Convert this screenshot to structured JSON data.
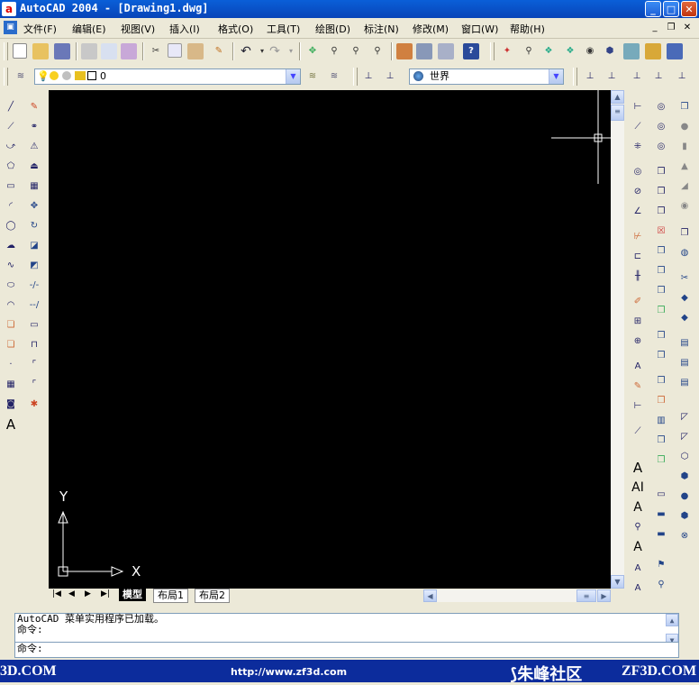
{
  "window": {
    "title": "AutoCAD 2004 - [Drawing1.dwg]",
    "app_icon": "a",
    "controls": {
      "minimize": "_",
      "maximize": "□",
      "close": "✕"
    }
  },
  "menu": {
    "items": [
      "文件(F)",
      "编辑(E)",
      "视图(V)",
      "插入(I)",
      "格式(O)",
      "工具(T)",
      "绘图(D)",
      "标注(N)",
      "修改(M)",
      "窗口(W)",
      "帮助(H)"
    ],
    "mdi_controls": {
      "minimize": "_",
      "restore": "❐",
      "close": "✕"
    }
  },
  "layers": {
    "current_layer": "0",
    "ucs_value": "世界"
  },
  "canvas": {
    "background": "#000000",
    "ucs_x_label": "X",
    "ucs_y_label": "Y"
  },
  "tabs": [
    "模型",
    "布局1",
    "布局2"
  ],
  "command": {
    "history": [
      "AutoCAD 菜单实用程序已加载。",
      "命令:"
    ],
    "prompt": "命令:"
  },
  "footer": {
    "left_logo": "3D.COM",
    "url": "http://www.zf3d.com",
    "brand_cn": "朱峰社区",
    "brand_en": "ZF3D.COM"
  },
  "colors": {
    "titlebar": "#0a5fd8",
    "footer": "#0c2c9c",
    "crosshair": "#ffffff"
  }
}
